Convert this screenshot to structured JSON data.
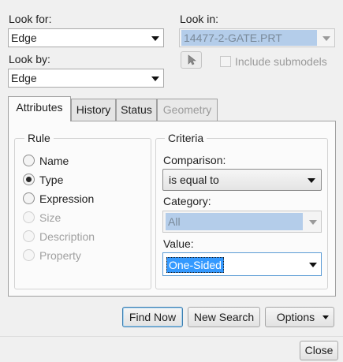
{
  "look_for": {
    "label": "Look for:",
    "value": "Edge"
  },
  "look_by": {
    "label": "Look by:",
    "value": "Edge"
  },
  "look_in": {
    "label": "Look in:",
    "value": "14477-2-GATE.PRT",
    "include_submodels": "Include submodels"
  },
  "tabs": [
    {
      "label": "Attributes",
      "state": "active"
    },
    {
      "label": "History",
      "state": "normal"
    },
    {
      "label": "Status",
      "state": "normal"
    },
    {
      "label": "Geometry",
      "state": "disabled"
    }
  ],
  "rule": {
    "title": "Rule",
    "options": [
      {
        "label": "Name",
        "checked": false,
        "enabled": true
      },
      {
        "label": "Type",
        "checked": true,
        "enabled": true
      },
      {
        "label": "Expression",
        "checked": false,
        "enabled": true
      },
      {
        "label": "Size",
        "checked": false,
        "enabled": false
      },
      {
        "label": "Description",
        "checked": false,
        "enabled": false
      },
      {
        "label": "Property",
        "checked": false,
        "enabled": false
      }
    ]
  },
  "criteria": {
    "title": "Criteria",
    "comparison_label": "Comparison:",
    "comparison_value": "is equal to",
    "category_label": "Category:",
    "category_value": "All",
    "value_label": "Value:",
    "value_value": "One-Sided"
  },
  "buttons": {
    "find_now": "Find Now",
    "new_search": "New Search",
    "options": "Options",
    "close": "Close"
  }
}
